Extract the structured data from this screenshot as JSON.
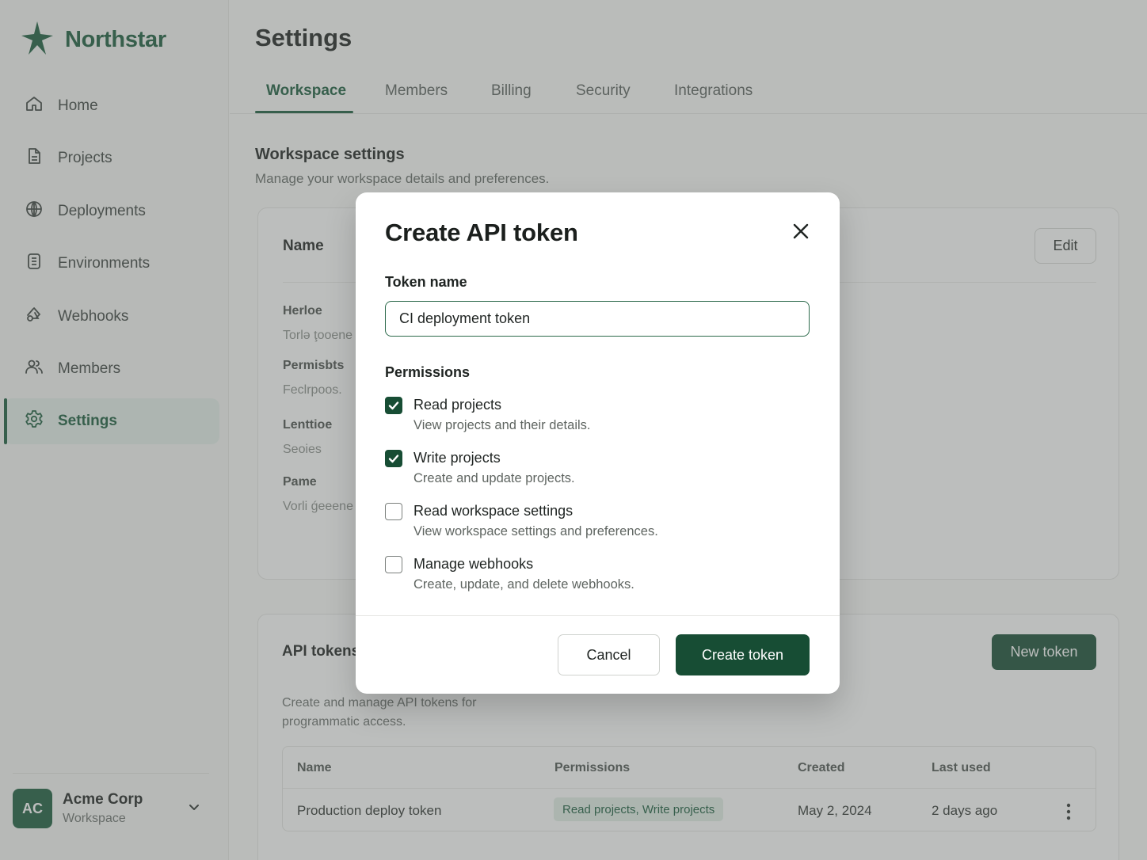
{
  "brand": {
    "name": "Northstar",
    "accent": "#1a5c3d"
  },
  "sidebar": {
    "items": [
      {
        "label": "Home",
        "icon": "home-icon"
      },
      {
        "label": "Projects",
        "icon": "document-icon"
      },
      {
        "label": "Deployments",
        "icon": "globe-icon"
      },
      {
        "label": "Environments",
        "icon": "server-icon"
      },
      {
        "label": "Webhooks",
        "icon": "webhook-icon"
      },
      {
        "label": "Members",
        "icon": "users-icon"
      },
      {
        "label": "Settings",
        "icon": "gear-icon",
        "active": true
      }
    ],
    "workspace": {
      "initials": "AC",
      "name": "Acme Corp",
      "subtitle": "Workspace"
    }
  },
  "page": {
    "title": "Settings",
    "tabs": [
      "Workspace",
      "Members",
      "Billing",
      "Security",
      "Integrations"
    ],
    "active_tab": "Workspace",
    "section_title": "Workspace settings",
    "section_desc": "Manage your workspace details and preferences."
  },
  "workspace_card": {
    "name_label": "Name",
    "edit_label": "Edit",
    "fields": [
      {
        "label": "Herloe",
        "value": "Torlə ţooene"
      },
      {
        "label": "Permisbts",
        "value": "Feclrpoos."
      },
      {
        "label": "Lenttioe",
        "value": "Seoies"
      },
      {
        "label": "Pame",
        "value": "Vorli ǵeeene"
      }
    ]
  },
  "api_tokens": {
    "title": "API tokens",
    "new_label": "New token",
    "desc": "Create and manage API tokens for programmatic access.",
    "columns": [
      "Name",
      "Permissions",
      "Created",
      "Last used"
    ],
    "rows": [
      {
        "name": "Production deploy token",
        "permissions": "Read projects, Write projects",
        "created": "May 2, 2024",
        "last_used": "2 days ago"
      }
    ]
  },
  "modal": {
    "title": "Create API token",
    "token_label": "Token name",
    "token_value": "CI deployment token",
    "permissions_label": "Permissions",
    "permissions": [
      {
        "name": "Read projects",
        "desc": "View projects and their details.",
        "checked": true
      },
      {
        "name": "Write projects",
        "desc": "Create and update projects.",
        "checked": true
      },
      {
        "name": "Read workspace settings",
        "desc": "View workspace settings and preferences.",
        "checked": false
      },
      {
        "name": "Manage webhooks",
        "desc": "Create, update, and delete webhooks.",
        "checked": false
      }
    ],
    "cancel_label": "Cancel",
    "create_label": "Create token"
  }
}
